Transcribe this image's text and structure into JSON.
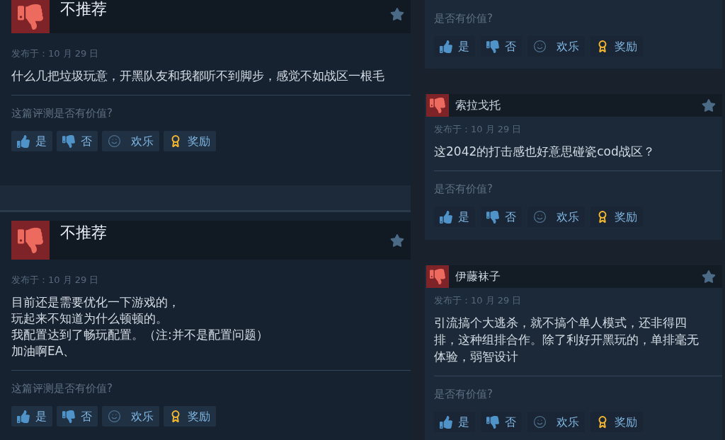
{
  "left_column": {
    "reviews": [
      {
        "kind": "full",
        "recommended": false,
        "title": "不推荐",
        "posted": "发布于：10 月 29 日",
        "lines": [
          "什么几把垃圾玩意，开黑队友和我都听不到脚步，感觉不如战区一根毛"
        ],
        "helpful_prompt": "这篇评测是否有价值?",
        "buttons": [
          {
            "kind": "yes",
            "label": "是"
          },
          {
            "kind": "no",
            "label": "否"
          },
          {
            "kind": "funny",
            "label": "欢乐"
          },
          {
            "kind": "award",
            "label": "奖励"
          }
        ]
      },
      {
        "kind": "full",
        "recommended": false,
        "title": "不推荐",
        "posted": "发布于：10 月 29 日",
        "lines": [
          "目前还是需要优化一下游戏的，",
          "玩起来不知道为什么顿顿的。",
          "我配置达到了畅玩配置。（注:并不是配置问题）",
          "加油啊EA、"
        ],
        "helpful_prompt": "这篇评测是否有价值?",
        "buttons": [
          {
            "kind": "yes",
            "label": "是"
          },
          {
            "kind": "no",
            "label": "否"
          },
          {
            "kind": "funny",
            "label": "欢乐"
          },
          {
            "kind": "award",
            "label": "奖励"
          }
        ]
      }
    ]
  },
  "right_column": {
    "reviews": [
      {
        "kind": "partial",
        "helpful_prompt": "是否有价值?",
        "buttons": [
          {
            "kind": "yes",
            "label": "是"
          },
          {
            "kind": "no",
            "label": "否"
          },
          {
            "kind": "funny",
            "label": "欢乐"
          },
          {
            "kind": "award",
            "label": "奖励"
          }
        ]
      },
      {
        "kind": "compact",
        "recommended": false,
        "author": "索拉戈托",
        "posted": "发布于：10 月 29 日",
        "lines": [
          "这2042的打击感也好意思碰瓷cod战区？"
        ],
        "helpful_prompt": "是否有价值?",
        "buttons": [
          {
            "kind": "yes",
            "label": "是"
          },
          {
            "kind": "no",
            "label": "否"
          },
          {
            "kind": "funny",
            "label": "欢乐"
          },
          {
            "kind": "award",
            "label": "奖励"
          }
        ]
      },
      {
        "kind": "compact",
        "recommended": false,
        "author": "伊藤袜子",
        "posted": "发布于：10 月 29 日",
        "lines": [
          "引流搞个大逃杀，就不搞个单人模式，还非得四",
          "排，这种组排合作。除了利好开黑玩的，单排毫无",
          "体验，弱智设计"
        ],
        "helpful_prompt": "是否有价值?",
        "buttons": [
          {
            "kind": "yes",
            "label": "是"
          },
          {
            "kind": "no",
            "label": "否"
          },
          {
            "kind": "funny",
            "label": "欢乐"
          },
          {
            "kind": "award",
            "label": "奖励"
          }
        ]
      }
    ]
  }
}
